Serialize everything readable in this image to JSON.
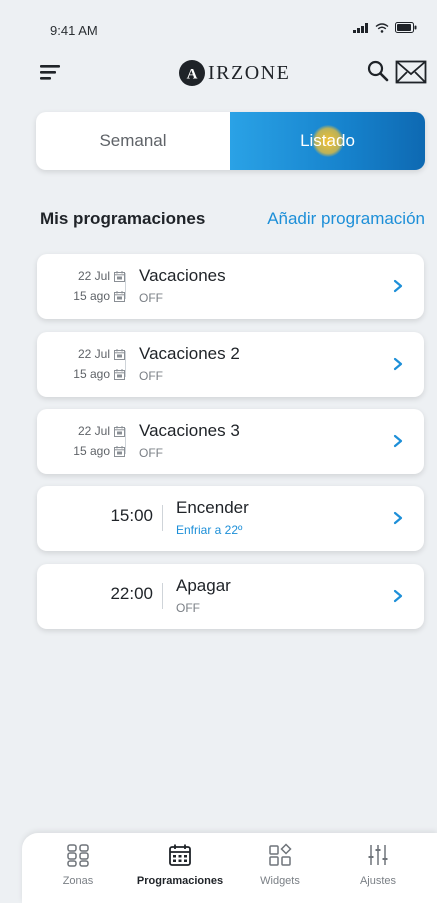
{
  "status": {
    "time": "9:41 AM"
  },
  "header": {
    "brand": "IRZONE",
    "brand_mark": "A"
  },
  "tabs": {
    "left": "Semanal",
    "right": "Listado"
  },
  "section": {
    "title": "Mis programaciones",
    "add_link": "Añadir programación"
  },
  "cards": [
    {
      "date_from": "22 Jul",
      "date_to": "15 ago",
      "title": "Vacaciones",
      "subtitle": "OFF"
    },
    {
      "date_from": "22 Jul",
      "date_to": "15 ago",
      "title": "Vacaciones 2",
      "subtitle": "OFF"
    },
    {
      "date_from": "22 Jul",
      "date_to": "15 ago",
      "title": "Vacaciones 3",
      "subtitle": "OFF"
    },
    {
      "time": "15:00",
      "title": "Encender",
      "subtitle": "Enfriar a 22º"
    },
    {
      "time": "22:00",
      "title": "Apagar",
      "subtitle": "OFF"
    }
  ],
  "nav": [
    {
      "label": "Zonas",
      "icon": "grid-icon"
    },
    {
      "label": "Programaciones",
      "icon": "calendar-icon",
      "active": true
    },
    {
      "label": "Widgets",
      "icon": "widgets-icon"
    },
    {
      "label": "Ajustes",
      "icon": "sliders-icon"
    }
  ],
  "colors": {
    "accent": "#1d8fd8",
    "background": "#edf0f3"
  }
}
